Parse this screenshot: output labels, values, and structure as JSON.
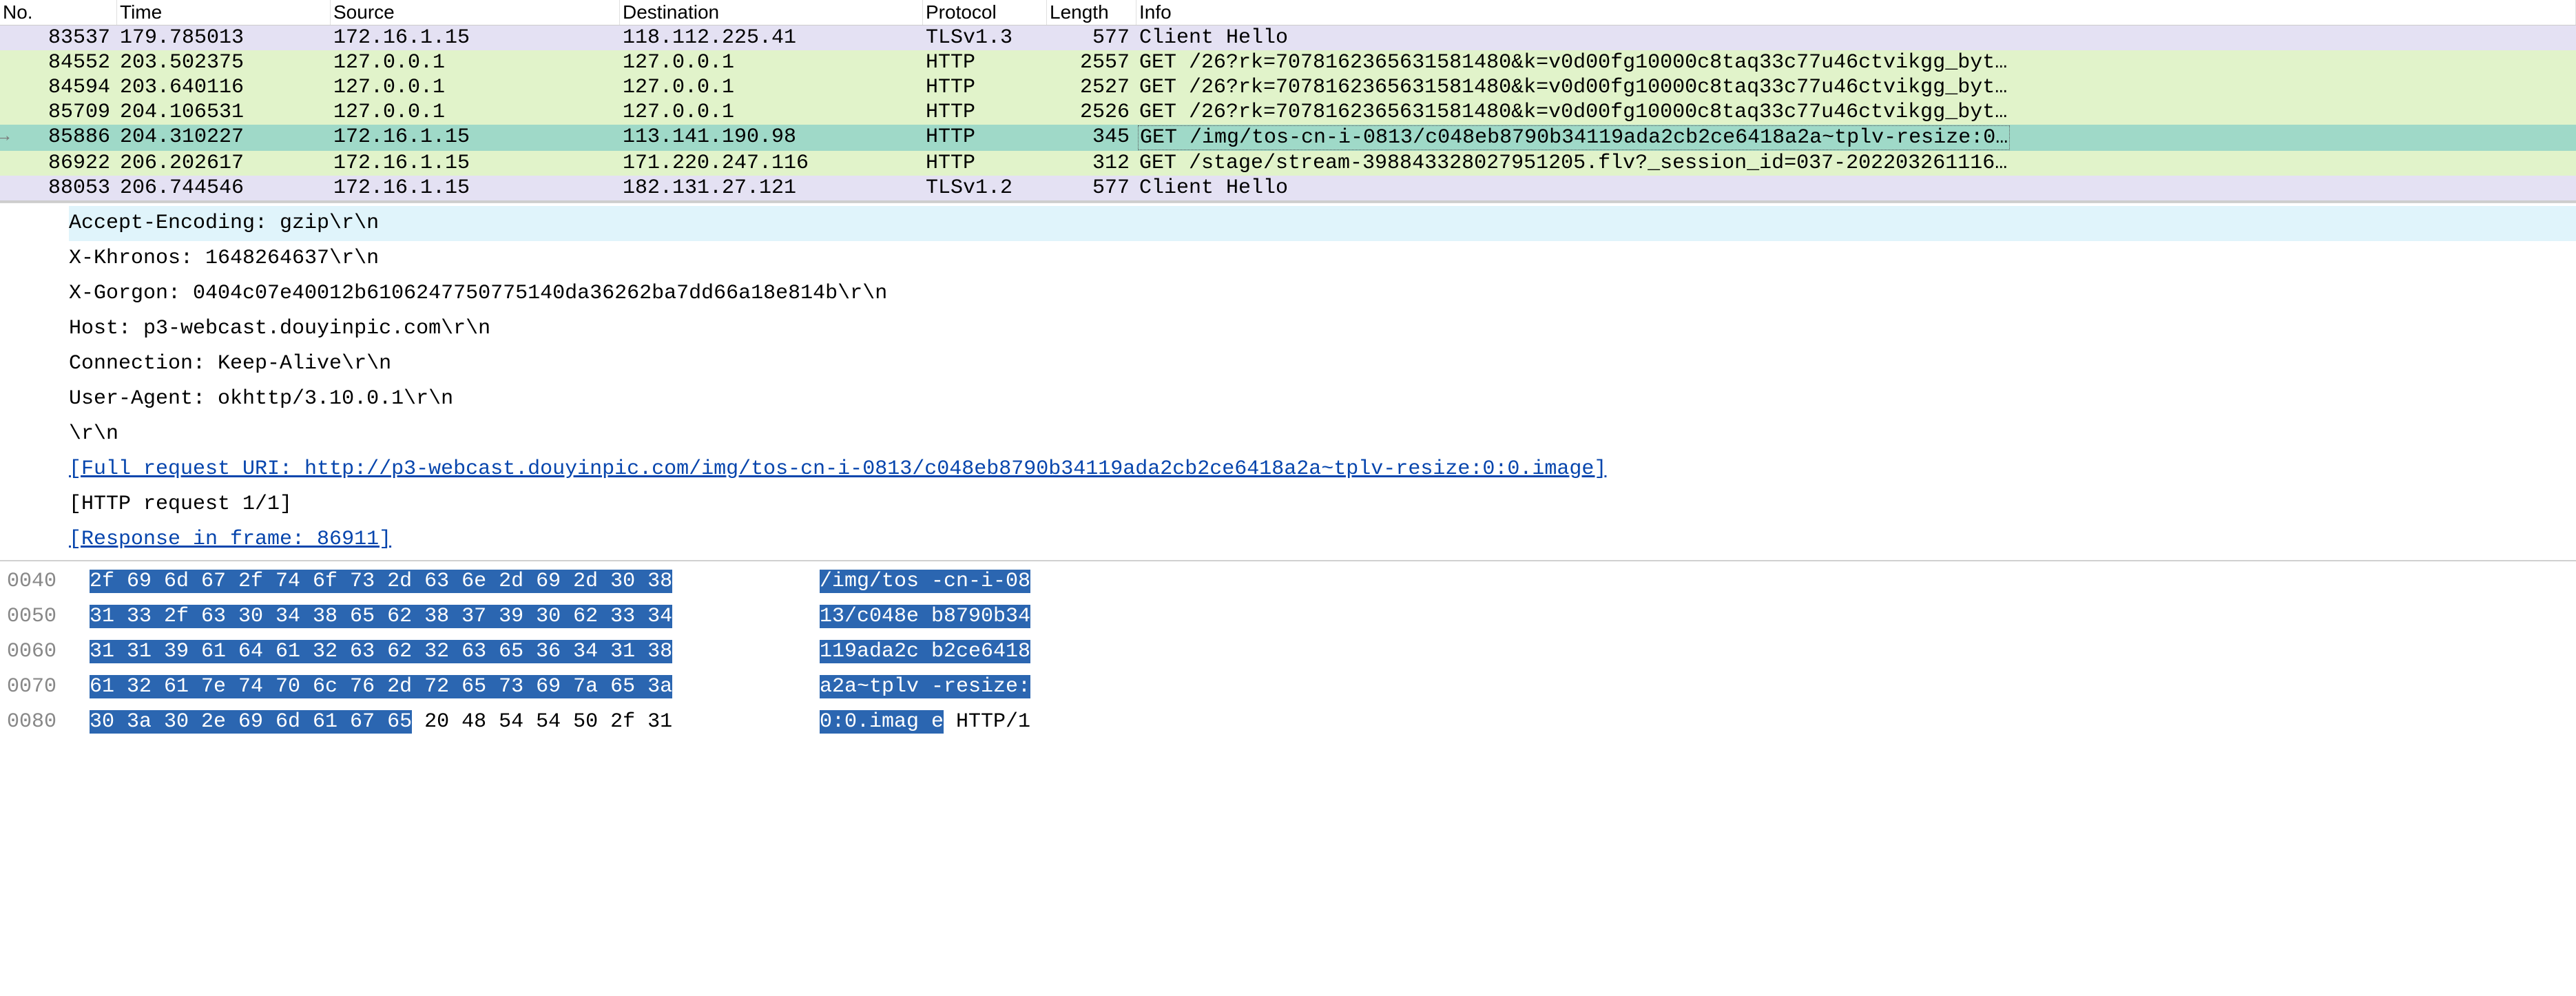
{
  "columns": {
    "no": "No.",
    "time": "Time",
    "source": "Source",
    "destination": "Destination",
    "protocol": "Protocol",
    "length": "Length",
    "info": "Info"
  },
  "packets": [
    {
      "no": "83537",
      "time": "179.785013",
      "src": "172.16.1.15",
      "dst": "118.112.225.41",
      "proto": "TLSv1.3",
      "len": "577",
      "info": "Client Hello",
      "class": "row-lavender"
    },
    {
      "no": "84552",
      "time": "203.502375",
      "src": "127.0.0.1",
      "dst": "127.0.0.1",
      "proto": "HTTP",
      "len": "2557",
      "info": "GET /26?rk=7078162365631581480&k=v0d00fg10000c8taq33c77u46ctvikgg_byt…",
      "class": "row-green"
    },
    {
      "no": "84594",
      "time": "203.640116",
      "src": "127.0.0.1",
      "dst": "127.0.0.1",
      "proto": "HTTP",
      "len": "2527",
      "info": "GET /26?rk=7078162365631581480&k=v0d00fg10000c8taq33c77u46ctvikgg_byt…",
      "class": "row-green"
    },
    {
      "no": "85709",
      "time": "204.106531",
      "src": "127.0.0.1",
      "dst": "127.0.0.1",
      "proto": "HTTP",
      "len": "2526",
      "info": "GET /26?rk=7078162365631581480&k=v0d00fg10000c8taq33c77u46ctvikgg_byt…",
      "class": "row-green"
    },
    {
      "no": "85886",
      "time": "204.310227",
      "src": "172.16.1.15",
      "dst": "113.141.190.98",
      "proto": "HTTP",
      "len": "345",
      "info": "GET /img/tos-cn-i-0813/c048eb8790b34119ada2cb2ce6418a2a~tplv-resize:0…",
      "class": "row-selected row-arrow",
      "boxed": true
    },
    {
      "no": "86922",
      "time": "206.202617",
      "src": "172.16.1.15",
      "dst": "171.220.247.116",
      "proto": "HTTP",
      "len": "312",
      "info": "GET /stage/stream-398843328027951205.flv?_session_id=037-202203261116…",
      "class": "row-green"
    },
    {
      "no": "88053",
      "time": "206.744546",
      "src": "172.16.1.15",
      "dst": "182.131.27.121",
      "proto": "TLSv1.2",
      "len": "577",
      "info": "Client Hello",
      "class": "row-lavender"
    }
  ],
  "details": {
    "l0": "Accept-Encoding: gzip\\r\\n",
    "l1": "X-Khronos: 1648264637\\r\\n",
    "l2": "X-Gorgon: 0404c07e40012b6106247750775140da36262ba7dd66a18e814b\\r\\n",
    "l3": "Host: p3-webcast.douyinpic.com\\r\\n",
    "l4": "Connection: Keep-Alive\\r\\n",
    "l5": "User-Agent: okhttp/3.10.0.1\\r\\n",
    "l6": "\\r\\n",
    "l7": "[Full request URI: http://p3-webcast.douyinpic.com/img/tos-cn-i-0813/c048eb8790b34119ada2cb2ce6418a2a~tplv-resize:0:0.image]",
    "l8": "[HTTP request 1/1]",
    "l9": "[Response in frame: 86911]"
  },
  "hex": [
    {
      "offset": "0040",
      "sel_bytes": "2f 69 6d 67 2f 74 6f 73  2d 63 6e 2d 69 2d 30 38",
      "norm_bytes": "",
      "sel_ascii": "/img/tos -cn-i-08",
      "norm_ascii": ""
    },
    {
      "offset": "0050",
      "sel_bytes": "31 33 2f 63 30 34 38 65  62 38 37 39 30 62 33 34",
      "norm_bytes": "",
      "sel_ascii": "13/c048e b8790b34",
      "norm_ascii": ""
    },
    {
      "offset": "0060",
      "sel_bytes": "31 31 39 61 64 61 32 63  62 32 63 65 36 34 31 38",
      "norm_bytes": "",
      "sel_ascii": "119ada2c b2ce6418",
      "norm_ascii": ""
    },
    {
      "offset": "0070",
      "sel_bytes": "61 32 61 7e 74 70 6c 76  2d 72 65 73 69 7a 65 3a",
      "norm_bytes": "",
      "sel_ascii": "a2a~tplv -resize:",
      "norm_ascii": ""
    },
    {
      "offset": "0080",
      "sel_bytes": "30 3a 30 2e 69 6d 61 67  65",
      "norm_bytes": " 20 48 54 54 50 2f 31",
      "sel_ascii": "0:0.imag e",
      "norm_ascii": " HTTP/1"
    }
  ]
}
